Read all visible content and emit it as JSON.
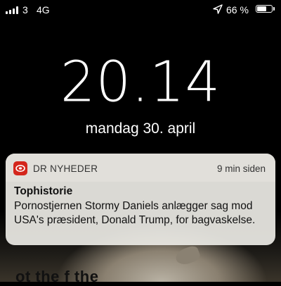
{
  "status_bar": {
    "carrier": "3",
    "network": "4G",
    "battery_percent": "66 %",
    "battery_level": 0.66,
    "signal_bars": 4,
    "location_icon": "location-arrow-icon"
  },
  "lock_screen": {
    "time": "20.14",
    "date": "mandag 30. april"
  },
  "notification": {
    "app_icon": "dr-app-icon",
    "app_name": "DR NYHEDER",
    "timestamp": "9 min siden",
    "title": "Tophistorie",
    "body": "Pornostjernen Stormy Daniels anlægger sag mod USA's præsident, Donald Trump, for bagvaskelse.",
    "accent_color": "#d4261c"
  },
  "wallpaper": {
    "partial_text": "ot the f        the"
  }
}
